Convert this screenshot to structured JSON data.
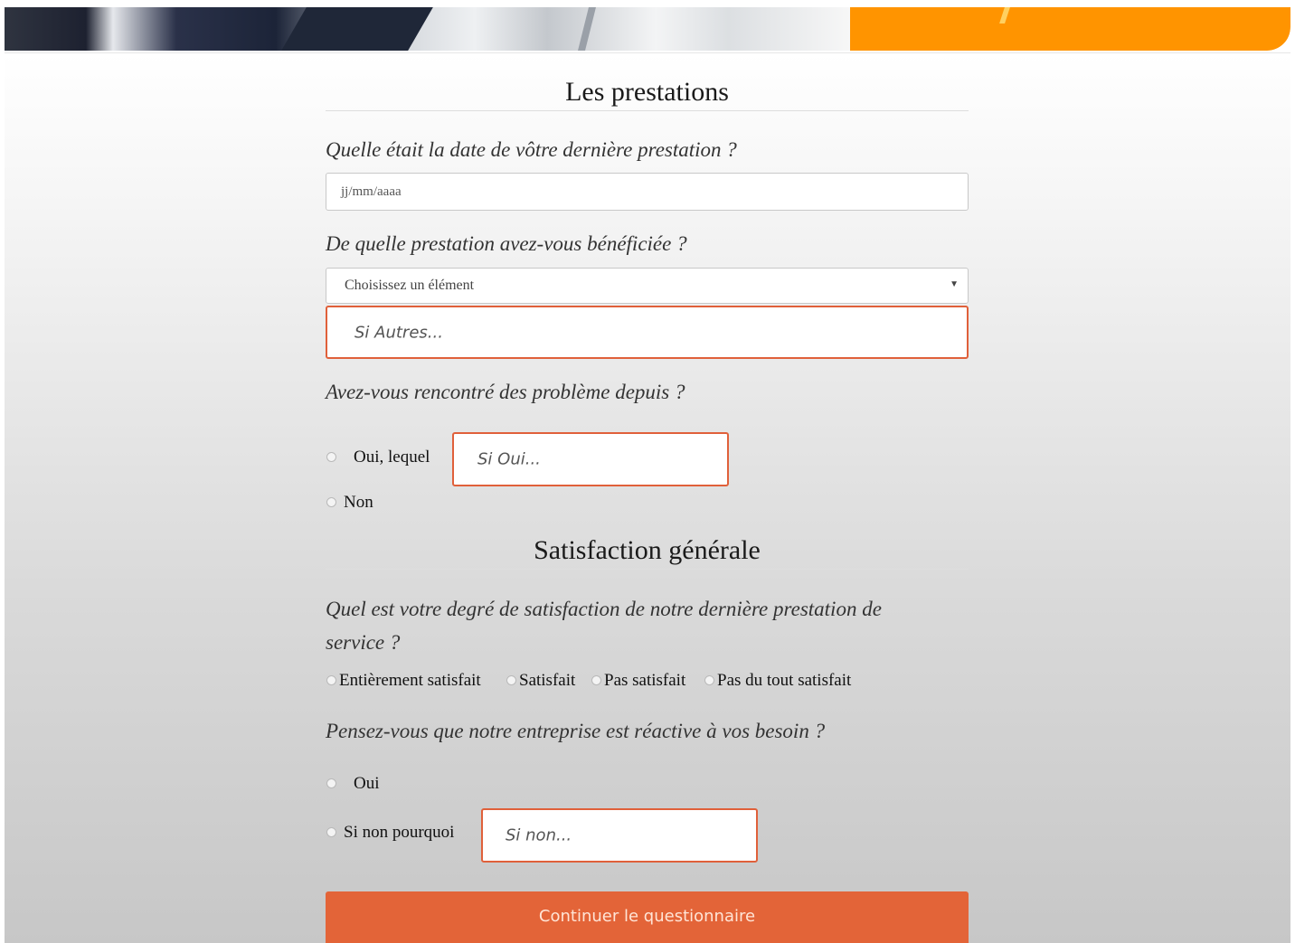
{
  "colors": {
    "accent_border": "#e0603a",
    "button_bg": "#e36438",
    "banner_orange": "#ff9400"
  },
  "section1": {
    "title": "Les prestations",
    "q_date": "Quelle était la date de vôtre dernière prestation ?",
    "date_placeholder": "jj/mm/aaaa",
    "q_prestation": "De quelle prestation avez-vous bénéficiée ?",
    "select_value": "Choisissez un élément",
    "other_placeholder": "Si Autres...",
    "q_problems": "Avez-vous rencontré des problème depuis ?",
    "opt_yes": "Oui, lequel",
    "yes_placeholder": "Si Oui...",
    "opt_no": "Non"
  },
  "section2": {
    "title": "Satisfaction générale",
    "q_satisfaction_line1": "Quel est votre degré de satisfaction de notre dernière prestation de",
    "q_satisfaction_line2": "service ?",
    "satisfaction_options": [
      "Entièrement satisfait",
      "Satisfait",
      "Pas satisfait",
      "Pas du tout satisfait"
    ],
    "q_reactive": "Pensez-vous que notre entreprise est réactive à vos besoin ?",
    "opt_yes": "Oui",
    "opt_no_why": "Si non pourquoi",
    "no_placeholder": "Si non..."
  },
  "button": {
    "label": "Continuer le questionnaire"
  }
}
